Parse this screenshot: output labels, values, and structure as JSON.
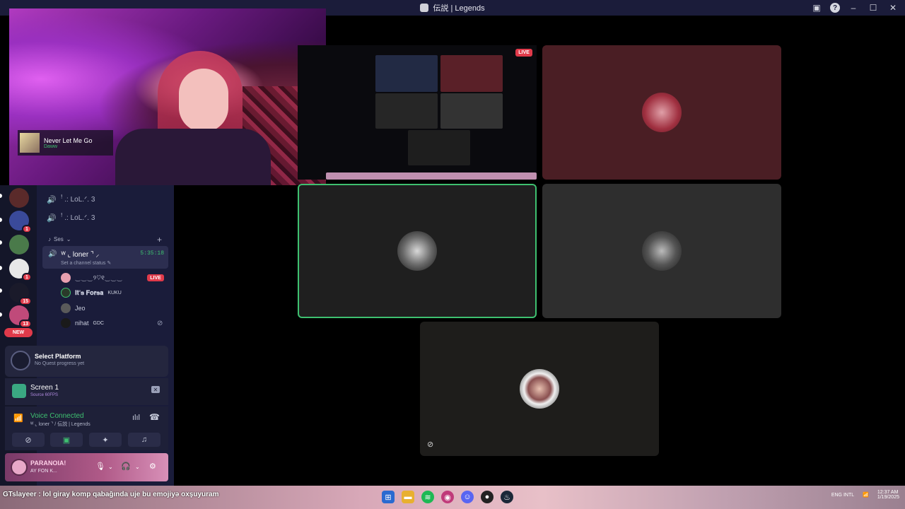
{
  "window": {
    "title": "伝説 | Legends"
  },
  "webcam": {
    "now_playing_title": "Never Let Me Go",
    "now_playing_artist": "Daww"
  },
  "servers": [
    {
      "name": "server-1",
      "color": "#5a2a2a",
      "badge": ""
    },
    {
      "name": "server-2",
      "color": "#3a4a9a",
      "badge": "1"
    },
    {
      "name": "server-3",
      "color": "#4a7a4a",
      "badge": ""
    },
    {
      "name": "server-4",
      "color": "#e8e8e8",
      "badge": "1"
    },
    {
      "name": "server-5",
      "color": "#1a1a2a",
      "badge": "15"
    },
    {
      "name": "server-6",
      "color": "#c04a7a",
      "badge": "13"
    }
  ],
  "rail": {
    "new_label": "NEW"
  },
  "channels": {
    "items": [
      {
        "label": "ꜝ .: LoL.ᐟ. 3"
      },
      {
        "label": "ꜝ .: LoL.ᐟ. 3"
      }
    ],
    "category": "Ses",
    "active": {
      "name": "ᵂ ⌞ loner ⌝ ⸝",
      "timer": "5:35:18",
      "status": "Set a channel status"
    },
    "members": [
      {
        "name": "‿‿‿୨♡୧‿‿‿",
        "tag": "",
        "color": "#e8a0b0"
      },
      {
        "name": "𝐈𝐭'𝐬 𝐅𝐨𝐫𝐬𝐚",
        "tag": "KUKU",
        "color": "#2a3a2a"
      },
      {
        "name": "Jeo",
        "tag": "",
        "color": "#5a5a5a"
      },
      {
        "name": "nihat",
        "tag": "GDC",
        "color": "#1a1a1a"
      }
    ],
    "live_label": "LIVE"
  },
  "quest": {
    "title": "Select Platform",
    "subtitle": "No Quest progress yet"
  },
  "screen_share": {
    "title": "Screen 1",
    "subtitle": "Source 60FPS"
  },
  "voice": {
    "status": "Voice Connected",
    "location": "ᵂ ⌞ loner ⌝ / 伝説 | Legends"
  },
  "user": {
    "name": "PARANOIA!",
    "status": "AY FON K..."
  },
  "stage": {
    "live_label": "LIVE"
  },
  "taskbar": {
    "ticker": "GTslayeer : lol giray komp qabağında uje bu emojiyə oxşuyuram",
    "lang": "ENG INTL",
    "time": "12:37 AM",
    "date": "1/19/2025"
  },
  "colors": {
    "accent_green": "#3ec070",
    "live_red": "#e03a4a",
    "panel_bg": "#1a1c3a"
  }
}
